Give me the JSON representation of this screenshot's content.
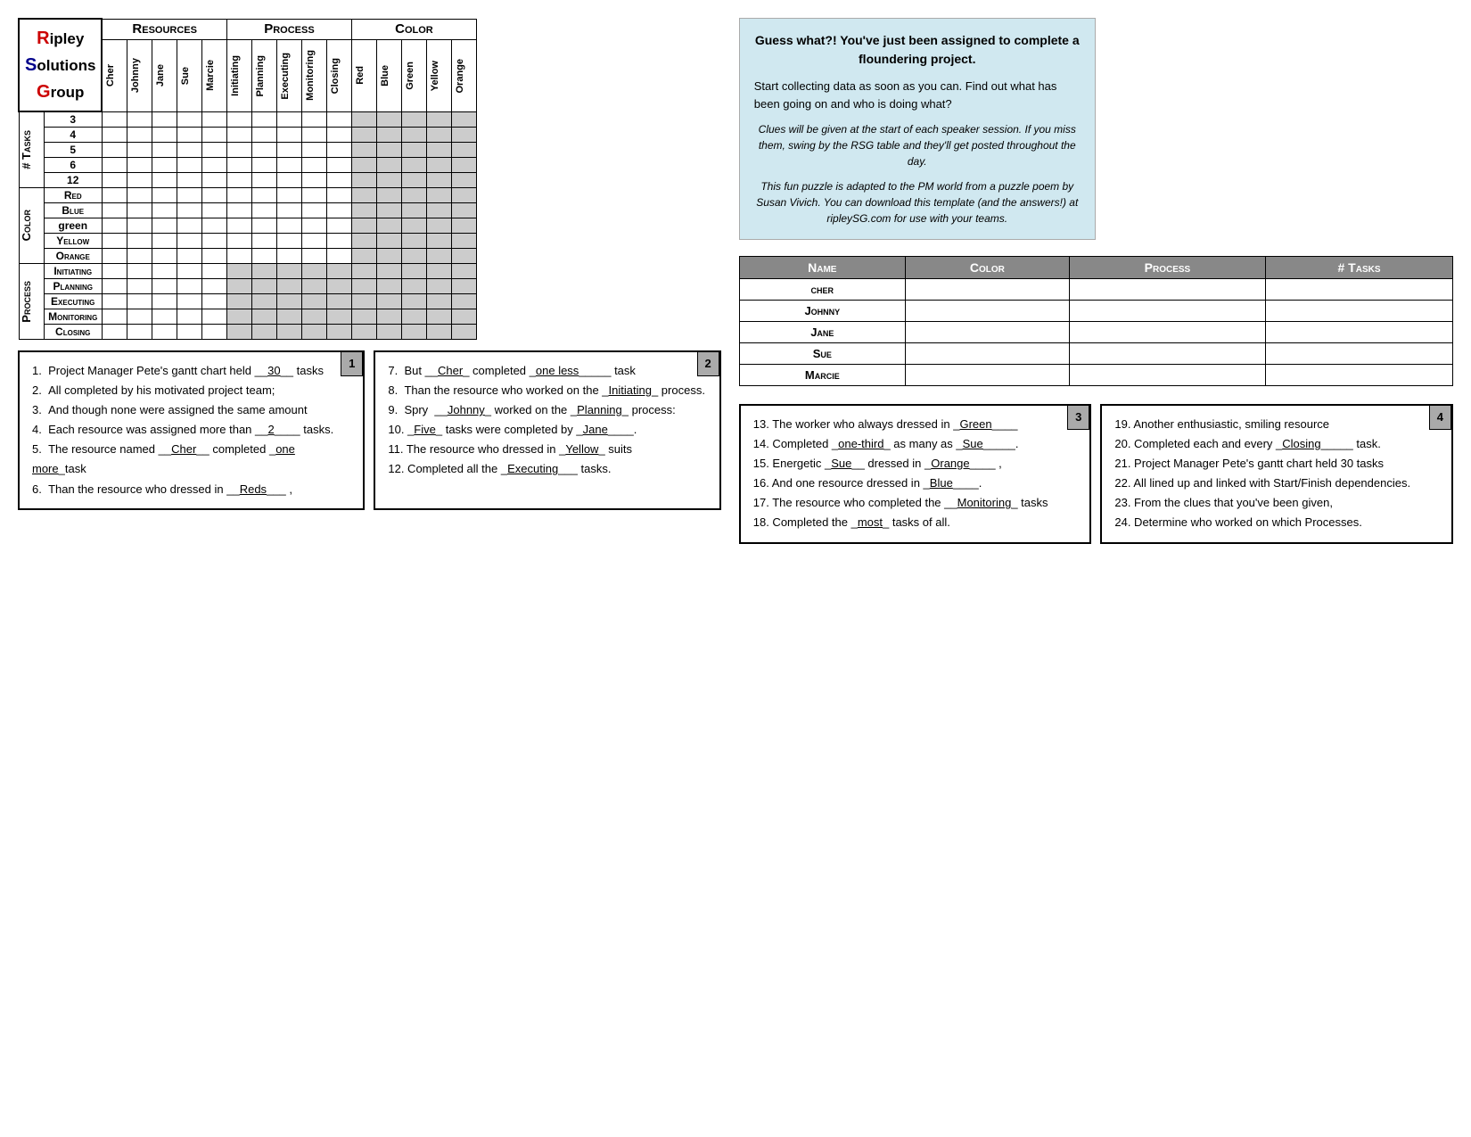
{
  "logo": {
    "line1": "ipley",
    "line2": "olutions",
    "line3": "roup"
  },
  "headers": {
    "resources": "Resources",
    "process": "Process",
    "color": "Color"
  },
  "columns": {
    "resources": [
      "Cher",
      "Johnny",
      "Jane",
      "Sue",
      "Marcie"
    ],
    "process": [
      "Initiating",
      "Planning",
      "Executing",
      "Monitoring",
      "Closing"
    ],
    "color": [
      "Red",
      "Blue",
      "Green",
      "Yellow",
      "Orange"
    ]
  },
  "row_sections": {
    "tasks": {
      "label": "# Tasks",
      "rows": [
        "3",
        "4",
        "5",
        "6",
        "12"
      ]
    },
    "color": {
      "label": "Color",
      "rows": [
        "Red",
        "Blue",
        "Green",
        "Yellow",
        "Orange"
      ]
    },
    "process": {
      "label": "Process",
      "rows": [
        "Initiating",
        "Planning",
        "Executing",
        "Monitoring",
        "Closing"
      ]
    }
  },
  "info_box": {
    "title": "Guess what?! You've just been assigned to complete a floundering project.",
    "para1": "Start collecting data as soon as you can.  Find out what has been going on and who is doing what?",
    "clue_note": "Clues will be given at the start of each speaker session.  If you miss them, swing by the RSG table and they'll get posted throughout the day.",
    "footer": "This fun puzzle is adapted to the PM world from a puzzle poem by Susan Vivich.  You can download this template (and the answers!) at ripleySG.com for use with your teams."
  },
  "summary_table": {
    "headers": [
      "Name",
      "Color",
      "Process",
      "# Tasks"
    ],
    "rows": [
      {
        "name": "Cher",
        "color": "",
        "process": "",
        "tasks": ""
      },
      {
        "name": "Johnny",
        "color": "",
        "process": "",
        "tasks": ""
      },
      {
        "name": "Jane",
        "color": "",
        "process": "",
        "tasks": ""
      },
      {
        "name": "Sue",
        "color": "",
        "process": "",
        "tasks": ""
      },
      {
        "name": "Marcie",
        "color": "",
        "process": "",
        "tasks": ""
      }
    ]
  },
  "clues": {
    "box1": {
      "number": "1",
      "items": [
        "1.  Project Manager Pete's gantt chart held __<u>30</u>__ tasks",
        "2.  All completed by his motivated project team;",
        "3.  And though none were assigned the same amount",
        "4.  Each resource was assigned more than __<u>2</u>____ tasks.",
        "5.  The resource named __<u>Cher</u>__ completed _<u>one more</u>_task",
        "6.  Than the resource who dressed in __<u>Reds</u>___ ,"
      ]
    },
    "box2": {
      "number": "2",
      "items": [
        "7.  But __<u>Cher</u>_ completed _<u>one less</u>_____ task",
        "8.  Than the resource who worked on the _<u>Initiating</u>_ process.",
        "9.  Spry  __<u>Johnny</u>_ worked on the _<u>Planning</u>_ process:",
        "10. _<u>Five</u>_ tasks were completed by _<u>Jane</u>____.",
        "11. The resource who dressed in _<u>Yellow</u>_ suits",
        "12. Completed all the _<u>Executing</u>___ tasks."
      ]
    },
    "box3": {
      "number": "3",
      "items": [
        "13. The worker who always dressed in _<u>Green</u>____",
        "14. Completed _<u>one-third</u>_ as many as _<u>Sue</u>_____.",
        "15. Energetic _<u>Sue</u>__ dressed in _<u>Orange</u>____ ,",
        "16. And one resource dressed in _<u>Blue</u>____.",
        "17. The resource who completed the __<u>Monitoring</u>_ tasks",
        "18. Completed the _<u>most</u>_ tasks of all."
      ]
    },
    "box4": {
      "number": "4",
      "items": [
        "19. Another enthusiastic, smiling resource",
        "20. Completed each and every _<u>Closing</u>_____ task.",
        "21. Project Manager Pete's gantt chart held 30 tasks",
        "22. All lined up and linked with Start/Finish dependencies.",
        "23. From the clues that you've been given,",
        "24. Determine who worked on which Processes."
      ]
    }
  }
}
